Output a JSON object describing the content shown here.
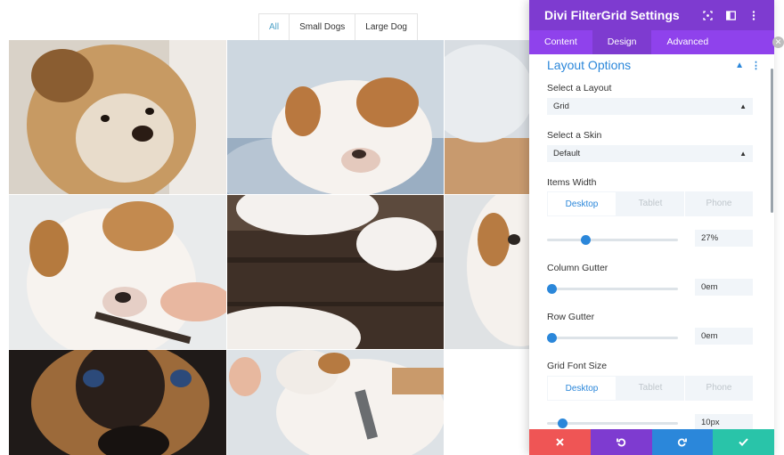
{
  "filters": {
    "tabs": [
      "All",
      "Small Dogs",
      "Large Dog"
    ],
    "active_index": 0
  },
  "panel": {
    "title": "Divi FilterGrid Settings",
    "header_icons": [
      "focus-icon",
      "sidebar-toggle-icon",
      "more-vertical-icon"
    ],
    "tabs": [
      "Content",
      "Design",
      "Advanced"
    ],
    "active_tab": "Design",
    "section_title": "Layout Options",
    "layout": {
      "label": "Select a Layout",
      "value": "Grid"
    },
    "skin": {
      "label": "Select a Skin",
      "value": "Default"
    },
    "items_width": {
      "label": "Items Width",
      "devices": [
        "Desktop",
        "Tablet",
        "Phone"
      ],
      "active_device": "Desktop",
      "value": "27%",
      "level": 0.28
    },
    "column_gutter": {
      "label": "Column Gutter",
      "value": "0em",
      "level": 0.0
    },
    "row_gutter": {
      "label": "Row Gutter",
      "value": "0em",
      "level": 0.0
    },
    "grid_font_size": {
      "label": "Grid Font Size",
      "devices": [
        "Desktop",
        "Tablet",
        "Phone"
      ],
      "active_device": "Desktop",
      "value": "10px",
      "level": 0.09
    },
    "footer_buttons": [
      {
        "name": "discard",
        "icon": "close-icon",
        "color": "#ef5555"
      },
      {
        "name": "undo",
        "icon": "undo-icon",
        "color": "#7e3bd0"
      },
      {
        "name": "redo",
        "icon": "redo-icon",
        "color": "#2b87da"
      },
      {
        "name": "save",
        "icon": "check-icon",
        "color": "#29c4a9"
      }
    ]
  },
  "photos": [
    {
      "subject": "terrier-closeup"
    },
    {
      "subject": "bulldog-on-blanket"
    },
    {
      "subject": "bulldog-partial"
    },
    {
      "subject": "bulldog-with-hand"
    },
    {
      "subject": "bulldog-paws-on-wood"
    },
    {
      "subject": "bulldog-partial-2"
    },
    {
      "subject": "black-tan-dog-eyes"
    },
    {
      "subject": "bulldog-with-collar"
    }
  ],
  "colors": {
    "panel_header": "#7e3bd0",
    "panel_tabs": "#8f42ec",
    "accent": "#2b87da",
    "filter_active": "#4ea2c8"
  }
}
